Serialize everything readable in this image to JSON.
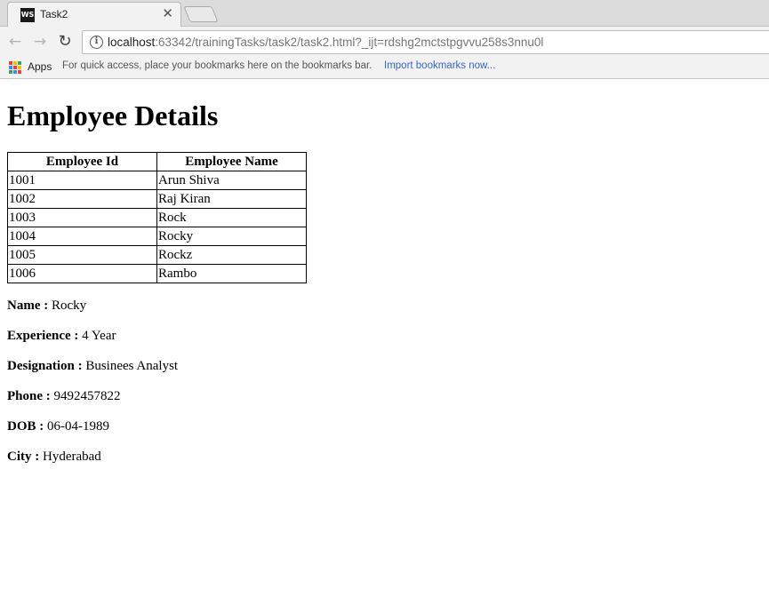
{
  "browser": {
    "tab_title": "Task2",
    "tab_favicon_text": "WS",
    "url_host": "localhost",
    "url_rest": ":63342/trainingTasks/task2/task2.html?_ijt=rdshg2mctstpgvvu258s3nnu0l",
    "bookmarks": {
      "apps_label": "Apps",
      "hint": "For quick access, place your bookmarks here on the bookmarks bar.",
      "import_link": "Import bookmarks now..."
    },
    "apps_colors": [
      "#ea4335",
      "#fbbc05",
      "#34a853",
      "#4285f4",
      "#ea4335",
      "#fbbc05",
      "#34a853",
      "#4285f4",
      "#ea4335"
    ]
  },
  "page": {
    "heading": "Employee Details",
    "table": {
      "headers": [
        "Employee Id",
        "Employee Name"
      ],
      "rows": [
        [
          "1001",
          "Arun Shiva"
        ],
        [
          "1002",
          "Raj Kiran"
        ],
        [
          "1003",
          "Rock"
        ],
        [
          "1004",
          "Rocky"
        ],
        [
          "1005",
          "Rockz"
        ],
        [
          "1006",
          "Rambo"
        ]
      ]
    },
    "details": [
      {
        "label": "Name :",
        "value": " Rocky"
      },
      {
        "label": "Experience :",
        "value": " 4 Year"
      },
      {
        "label": "Designation :",
        "value": " Businees Analyst"
      },
      {
        "label": "Phone :",
        "value": " 9492457822"
      },
      {
        "label": "DOB :",
        "value": " 06-04-1989"
      },
      {
        "label": "City :",
        "value": " Hyderabad"
      }
    ]
  }
}
